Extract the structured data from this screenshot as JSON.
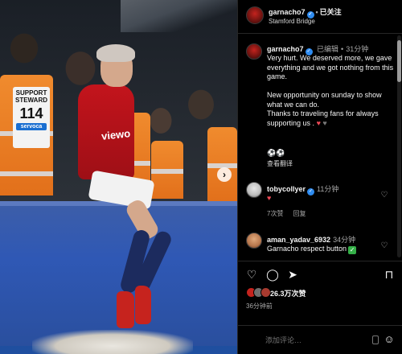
{
  "post": {
    "username": "garnacho7",
    "separator": "•",
    "follow_label": "已关注",
    "location": "Stamford Bridge"
  },
  "photo": {
    "steward_label_line1": "SUPPORT",
    "steward_label_line2": "STEWARD",
    "steward_number": "114",
    "steward_sponsor": "servoca",
    "shirt_sponsor": "viewo",
    "next_arrow": "›"
  },
  "caption": {
    "username": "garnacho7",
    "edited": "已编辑",
    "separator": "•",
    "time": "31分钟",
    "line1": "Very hurt. We deserved more, we gave everything and we got nothing from this game.",
    "line2": "New opportunity on sunday to show what we can do.",
    "line3": "Thanks to traveling fans for always supporting us .",
    "heart_red": "♥",
    "heart_black": "♥",
    "emoji_row": "⚽⚽",
    "translate_label": "查看翻译"
  },
  "comments": [
    {
      "username": "tobycollyer",
      "time": "11分钟",
      "text": "♥",
      "likes_label": "7次赞",
      "reply_label": "回复",
      "like_icon": "♡"
    },
    {
      "username": "aman_yadav_6932",
      "time": "34分钟",
      "text": "Garnacho respect button",
      "check": "✓",
      "like_icon": "♡"
    }
  ],
  "actions": {
    "like_icon": "♡",
    "comment_icon": "◯",
    "share_icon": "➤",
    "save_icon": "⊓",
    "likes_count": "26.3万次赞",
    "time_ago": "36分钟前"
  },
  "add_comment": {
    "placeholder": "添加评论…",
    "emoji_icon": "☺"
  },
  "icons": {
    "verified": "✓"
  },
  "colors": {
    "background": "#000000",
    "verified_blue": "#2f8cf0",
    "heart_red": "#ed4956",
    "check_green": "#35b048",
    "muted_text": "#a8a8a8"
  }
}
